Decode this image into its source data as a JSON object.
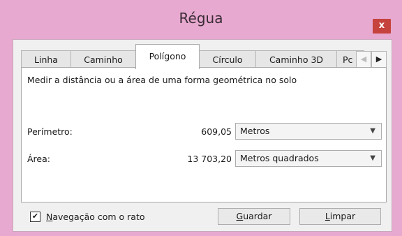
{
  "window": {
    "title": "Régua",
    "close_label": "x"
  },
  "tabs": [
    {
      "label": "Linha",
      "active": false
    },
    {
      "label": "Caminho",
      "active": false
    },
    {
      "label": "Polígono",
      "active": true
    },
    {
      "label": "Círculo",
      "active": false
    },
    {
      "label": "Caminho 3D",
      "active": false
    },
    {
      "label": "Pc",
      "active": false
    }
  ],
  "tab_scroll": {
    "left_icon": "chevron-left-icon",
    "right_icon": "chevron-right-icon",
    "left_glyph": "◀",
    "right_glyph": "▶"
  },
  "panel": {
    "description": "Medir a distância ou a área de uma forma geométrica no solo",
    "perimeter": {
      "label": "Perímetro:",
      "value": "609,05",
      "unit": "Metros"
    },
    "area": {
      "label": "Área:",
      "value": "13 703,20",
      "unit": "Metros quadrados"
    }
  },
  "footer": {
    "checkbox": {
      "checked": true,
      "mnemonic": "N",
      "rest": "avegação com o rato",
      "mark": "✔"
    },
    "save": {
      "mnemonic": "G",
      "rest": "uardar"
    },
    "clear": {
      "mnemonic": "L",
      "rest": "impar"
    }
  },
  "colors": {
    "frame": "#e7a9cf",
    "close": "#c6423c",
    "client": "#f0f0f0"
  }
}
